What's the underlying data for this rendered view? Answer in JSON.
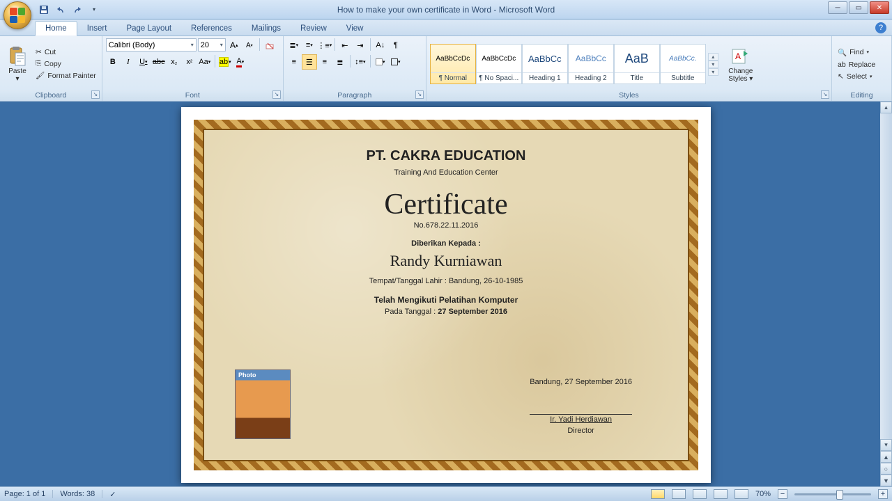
{
  "app": {
    "title": "How to make your own certificate in Word - Microsoft Word"
  },
  "qat": {
    "save": "Save",
    "undo": "Undo",
    "redo": "Redo"
  },
  "tabs": [
    "Home",
    "Insert",
    "Page Layout",
    "References",
    "Mailings",
    "Review",
    "View"
  ],
  "activeTab": 0,
  "ribbon": {
    "clipboard": {
      "label": "Clipboard",
      "paste": "Paste",
      "cut": "Cut",
      "copy": "Copy",
      "fmt": "Format Painter"
    },
    "font": {
      "label": "Font",
      "family": "Calibri (Body)",
      "size": "20"
    },
    "para": {
      "label": "Paragraph"
    },
    "styles": {
      "label": "Styles",
      "change": "Change Styles",
      "items": [
        {
          "preview": "AaBbCcDc",
          "name": "¶ Normal",
          "sel": true
        },
        {
          "preview": "AaBbCcDc",
          "name": "¶ No Spaci...",
          "sel": false
        },
        {
          "preview": "AaBbCc",
          "name": "Heading 1",
          "sel": false,
          "color": "#1f497d",
          "size": "13px"
        },
        {
          "preview": "AaBbCc",
          "name": "Heading 2",
          "sel": false,
          "color": "#4f81bd",
          "size": "12px"
        },
        {
          "preview": "AaB",
          "name": "Title",
          "sel": false,
          "color": "#1f497d",
          "size": "18px"
        },
        {
          "preview": "AaBbCc.",
          "name": "Subtitle",
          "sel": false,
          "color": "#4f81bd",
          "italic": true
        }
      ]
    },
    "editing": {
      "label": "Editing",
      "find": "Find",
      "replace": "Replace",
      "select": "Select"
    }
  },
  "doc": {
    "company": "PT. CAKRA EDUCATION",
    "subtitle": "Training And Education Center",
    "certTitle": "Certificate",
    "certNo": "No.678.22.11.2016",
    "givenTo": "Diberikan Kepada :",
    "name": "Randy Kurniawan",
    "born": "Tempat/Tanggal Lahir : Bandung, 26-10-1985",
    "attended": "Telah Mengikuti Pelatihan Komputer",
    "onDateLabel": "Pada Tanggal :",
    "onDate": "27 September 2016",
    "placeDate": "Bandung, 27 September 2016",
    "signer": "Ir. Yadi Herdiawan",
    "signerTitle": "Director",
    "photoLabel": "Photo"
  },
  "status": {
    "page": "Page: 1 of 1",
    "words": "Words: 38",
    "zoom": "70%"
  }
}
